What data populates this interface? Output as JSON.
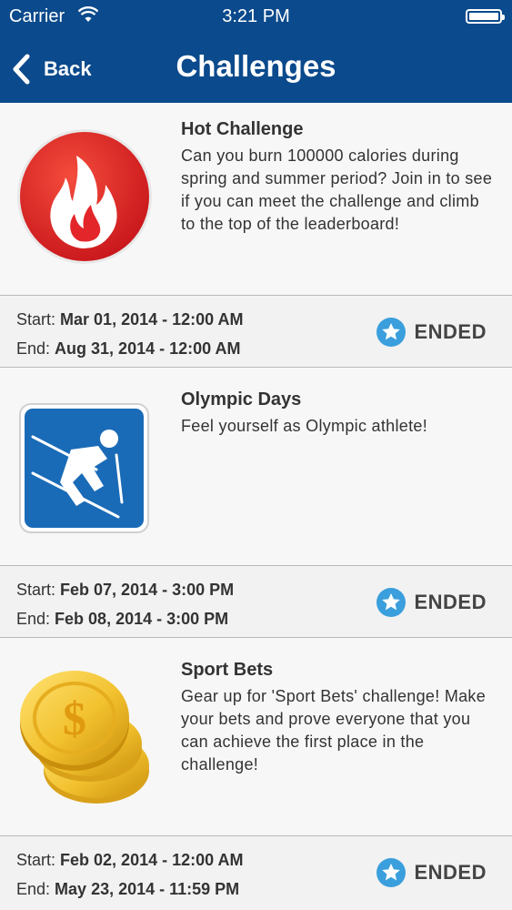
{
  "status_bar": {
    "carrier": "Carrier",
    "time": "3:21 PM"
  },
  "nav": {
    "back_label": "Back",
    "title": "Challenges"
  },
  "challenges": [
    {
      "name": "Hot Challenge",
      "description": "Can you burn 100000 calories during spring and summer period? Join in to see if you can meet the challenge and climb to the top of the leaderboard!",
      "icon": "flame-icon",
      "start_label": "Start:",
      "start": "Mar 01, 2014 - 12:00 AM",
      "end_label": "End:",
      "end": "Aug 31, 2014 - 12:00 AM",
      "status": "ENDED"
    },
    {
      "name": "Olympic Days",
      "description": "Feel yourself as Olympic athlete!",
      "icon": "skier-icon",
      "start_label": "Start:",
      "start": "Feb 07, 2014 - 3:00 PM",
      "end_label": "End:",
      "end": "Feb 08, 2014 - 3:00 PM",
      "status": "ENDED"
    },
    {
      "name": "Sport Bets",
      "description": "Gear up for 'Sport Bets' challenge! Make your bets and prove everyone that you can achieve the first place in the challenge!",
      "icon": "coins-icon",
      "start_label": "Start:",
      "start": "Feb 02, 2014 - 12:00 AM",
      "end_label": "End:",
      "end": "May 23, 2014 - 11:59 PM",
      "status": "ENDED"
    }
  ],
  "colors": {
    "header": "#0b4a8c",
    "badge_star": "#3a9fdc",
    "flame_red": "#e3262a",
    "ski_blue": "#1a6bb7",
    "coin_gold": "#f2c12e"
  }
}
